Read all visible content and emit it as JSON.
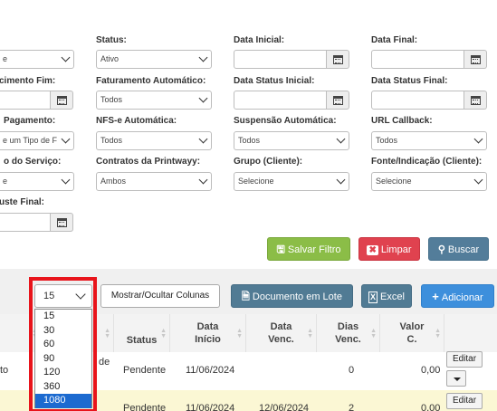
{
  "filters": {
    "row1": {
      "col1_value": "e",
      "status_label": "Status:",
      "status_value": "Ativo",
      "data_inicial_label": "Data Inicial:",
      "data_final_label": "Data Final:"
    },
    "row2": {
      "col1_label": "cimento Fim:",
      "faturamento_label": "Faturamento Automático:",
      "faturamento_value": "Todos",
      "data_status_inicial_label": "Data Status Inicial:",
      "data_status_final_label": "Data Status Final:"
    },
    "row3": {
      "col1_label": "Pagamento:",
      "col1_value": "e um Tipo de F",
      "nfse_label": "NFS-e Automática:",
      "nfse_value": "Todos",
      "suspensao_label": "Suspensão Automática:",
      "suspensao_value": "Todos",
      "url_label": "URL Callback:",
      "url_value": "Todos"
    },
    "row4": {
      "col1_label": "o do Serviço:",
      "col1_value": "e",
      "contratos_label": "Contratos da Printwayy:",
      "contratos_value": "Ambos",
      "grupo_label": "Grupo (Cliente):",
      "grupo_value": "Selecione",
      "fonte_label": "Fonte/Indicação (Cliente):",
      "fonte_value": "Selecione"
    },
    "row5": {
      "col1_label": "uste Final:"
    }
  },
  "actions": {
    "salvar_label": "Salvar Filtro",
    "limpar_label": "Limpar",
    "buscar_label": "Buscar"
  },
  "toolbar": {
    "page_size_value": "15",
    "page_size_options": [
      "15",
      "30",
      "60",
      "90",
      "120",
      "360",
      "1080"
    ],
    "highlighted_option": "1080",
    "columns_label": "Mostrar/Ocultar Colunas",
    "lote_label": "Documento em Lote",
    "excel_label": "Excel",
    "adicionar_label": "Adicionar"
  },
  "table": {
    "headers": {
      "status": "Status",
      "data_inicio": "Data Início",
      "data_venc": "Data Venc.",
      "dias_venc": "Dias Venc.",
      "valor": "Valor C."
    },
    "rows": [
      {
        "col1_fragment": "to",
        "col2_fragment": "de",
        "status": "Pendente",
        "data_inicio": "11/06/2024",
        "data_venc": "",
        "dias_venc": "0",
        "valor": "0,00",
        "edit_label": "Editar"
      },
      {
        "col1_fragment": "",
        "col2_fragment": "",
        "status": "Pendente",
        "data_inicio": "11/06/2024",
        "data_venc": "12/06/2024",
        "dias_venc": "2",
        "valor": "0,00",
        "edit_label": "Editar"
      }
    ]
  },
  "colors": {
    "salvar": "#8bbd47",
    "limpar": "#e0424f",
    "buscar": "#537d9a",
    "lote": "#517b94",
    "adicionar": "#3d8fdc",
    "highlight": "#1c6ad0",
    "callout": "#e8141b",
    "row_highlight": "#fbf7d4"
  }
}
